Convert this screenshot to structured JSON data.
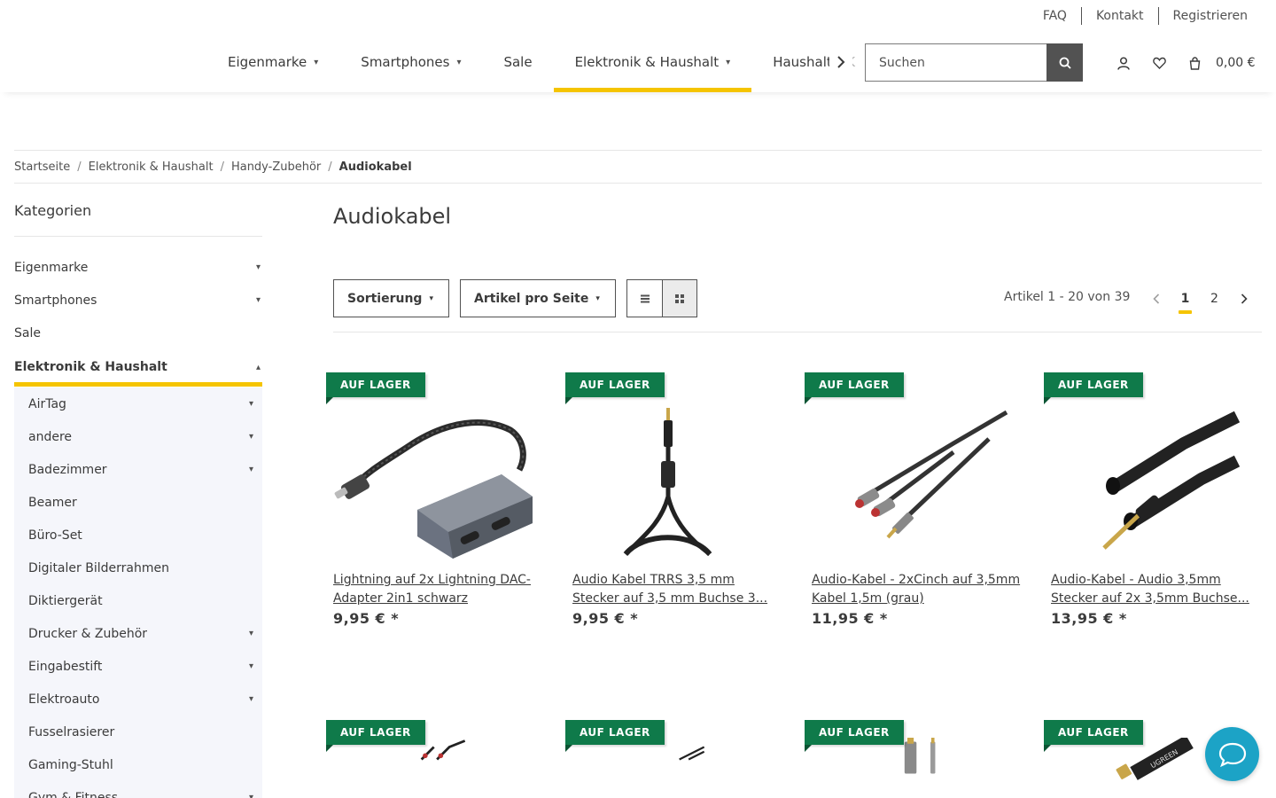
{
  "top_links": [
    "FAQ",
    "Kontakt",
    "Registrieren"
  ],
  "nav": {
    "items": [
      {
        "label": "Eigenmarke",
        "has_caret": true
      },
      {
        "label": "Smartphones",
        "has_caret": true
      },
      {
        "label": "Sale",
        "has_caret": false
      },
      {
        "label": "Elektronik & Haushalt",
        "has_caret": true,
        "active": true
      }
    ],
    "partial_label": "Haushalt & ",
    "partial_fade": "K",
    "next_icon": "chevron-right-icon"
  },
  "search": {
    "placeholder": "Suchen",
    "button_icon": "search-icon"
  },
  "header_icons": [
    "user-icon",
    "heart-icon",
    "cart-icon"
  ],
  "cart_total": "0,00 €",
  "breadcrumb": {
    "items": [
      "Startseite",
      "Elektronik & Haushalt",
      "Handy-Zubehör"
    ],
    "current": "Audiokabel"
  },
  "sidebar": {
    "title": "Kategorien",
    "items": [
      {
        "label": "Eigenmarke",
        "arrow": true
      },
      {
        "label": "Smartphones",
        "arrow": true
      },
      {
        "label": "Sale",
        "arrow": false
      },
      {
        "label": "Elektronik & Haushalt",
        "arrow": true,
        "active": true
      }
    ],
    "sub_items": [
      {
        "label": "AirTag",
        "arrow": true
      },
      {
        "label": "andere",
        "arrow": true
      },
      {
        "label": "Badezimmer",
        "arrow": true
      },
      {
        "label": "Beamer",
        "arrow": false
      },
      {
        "label": "Büro-Set",
        "arrow": false
      },
      {
        "label": "Digitaler Bilderrahmen",
        "arrow": false
      },
      {
        "label": "Diktiergerät",
        "arrow": false
      },
      {
        "label": "Drucker & Zubehör",
        "arrow": true
      },
      {
        "label": "Eingabestift",
        "arrow": true
      },
      {
        "label": "Elektroauto",
        "arrow": true
      },
      {
        "label": "Fusselrasierer",
        "arrow": false
      },
      {
        "label": "Gaming-Stuhl",
        "arrow": false
      },
      {
        "label": "Gym & Fitness",
        "arrow": true
      }
    ]
  },
  "main": {
    "title": "Audiokabel",
    "sort_label": "Sortierung",
    "per_page_label": "Artikel pro Seite",
    "count_text": "Artikel 1 - 20 von 39",
    "pages": [
      "1",
      "2"
    ],
    "current_page": "1"
  },
  "products": [
    {
      "badge": "AUF LAGER",
      "name": "Lightning auf 2x Lightning DAC-Adapter 2in1 schwarz",
      "price": "9,95 € *"
    },
    {
      "badge": "AUF LAGER",
      "name": "Audio Kabel TRRS 3,5 mm Stecker auf 3,5 mm Buchse 3...",
      "price": "9,95 € *"
    },
    {
      "badge": "AUF LAGER",
      "name": "Audio-Kabel - 2xCinch auf 3,5mm Kabel 1,5m (grau)",
      "price": "11,95 € *"
    },
    {
      "badge": "AUF LAGER",
      "name": "Audio-Kabel - Audio 3,5mm Stecker auf 2x 3,5mm Buchse...",
      "price": "13,95 € *"
    },
    {
      "badge": "AUF LAGER"
    },
    {
      "badge": "AUF LAGER"
    },
    {
      "badge": "AUF LAGER"
    },
    {
      "badge": "AUF LAGER",
      "image_text": "UGREEN"
    }
  ],
  "chat_icon": "chat-bubble-icon",
  "colors": {
    "accent": "#f5c400",
    "badge": "#0f7a4a",
    "chat": "#1ca3c6",
    "search_button": "#525252"
  }
}
